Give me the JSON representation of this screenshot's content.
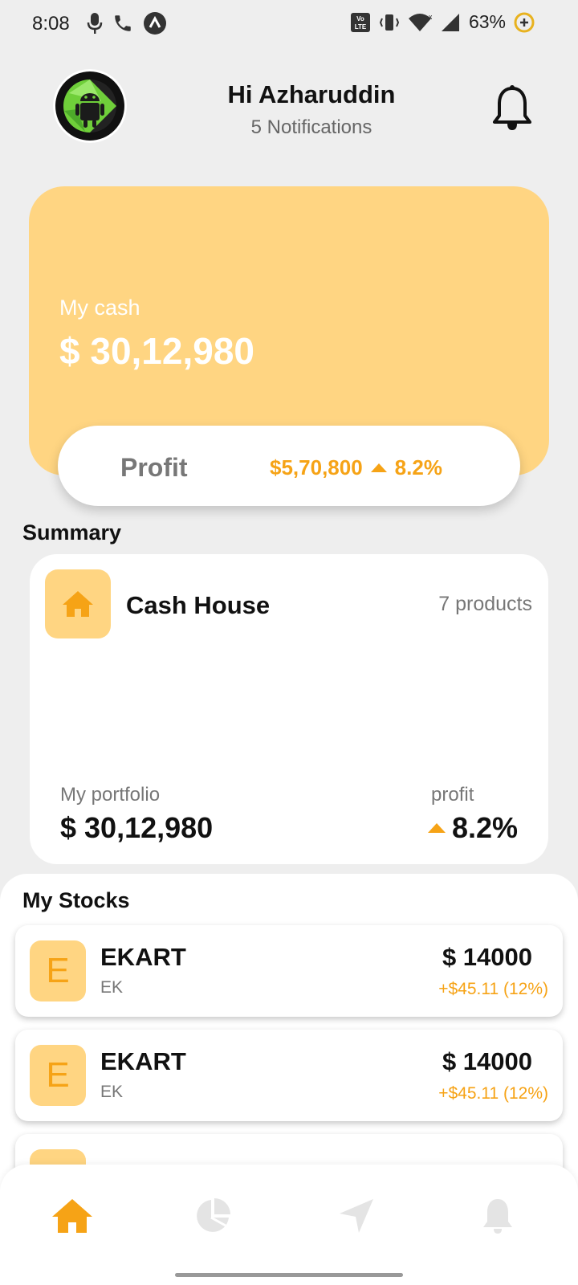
{
  "status_bar": {
    "time": "8:08",
    "battery": "63%",
    "icons": [
      "mic-icon",
      "call-icon",
      "app-badge-icon",
      "volte-icon",
      "vibrate-icon",
      "wifi-icon",
      "signal-icon",
      "battery-saver-icon"
    ]
  },
  "header": {
    "avatar_alt": "ANDROID CLUB · VIT - CHENNAI",
    "greeting": "Hi Azharuddin",
    "notifications": "5 Notifications"
  },
  "cash_card": {
    "label": "My cash",
    "value": "$ 30,12,980",
    "profit_label": "Profit",
    "profit_amount": "$5,70,800",
    "profit_percent": "8.2%"
  },
  "summary": {
    "title": "Summary",
    "name": "Cash House",
    "count": "7 products",
    "portfolio_label": "My portfolio",
    "portfolio_value": "$ 30,12,980",
    "profit_label": "profit",
    "profit_value": "8.2%"
  },
  "stocks": {
    "title": "My Stocks",
    "items": [
      {
        "initial": "E",
        "name": "EKART",
        "ticker": "EK",
        "price": "$ 14000",
        "change": "+$45.11 (12%)"
      },
      {
        "initial": "E",
        "name": "EKART",
        "ticker": "EK",
        "price": "$ 14000",
        "change": "+$45.11 (12%)"
      },
      {
        "initial": "",
        "name": "",
        "ticker": "",
        "price": "",
        "change": ""
      }
    ]
  },
  "bottom_nav": {
    "items": [
      "home",
      "portfolio",
      "explore",
      "notifications"
    ],
    "active": "home"
  },
  "colors": {
    "accent": "#f6a316",
    "card": "#ffd582",
    "background": "#eeeeee"
  }
}
